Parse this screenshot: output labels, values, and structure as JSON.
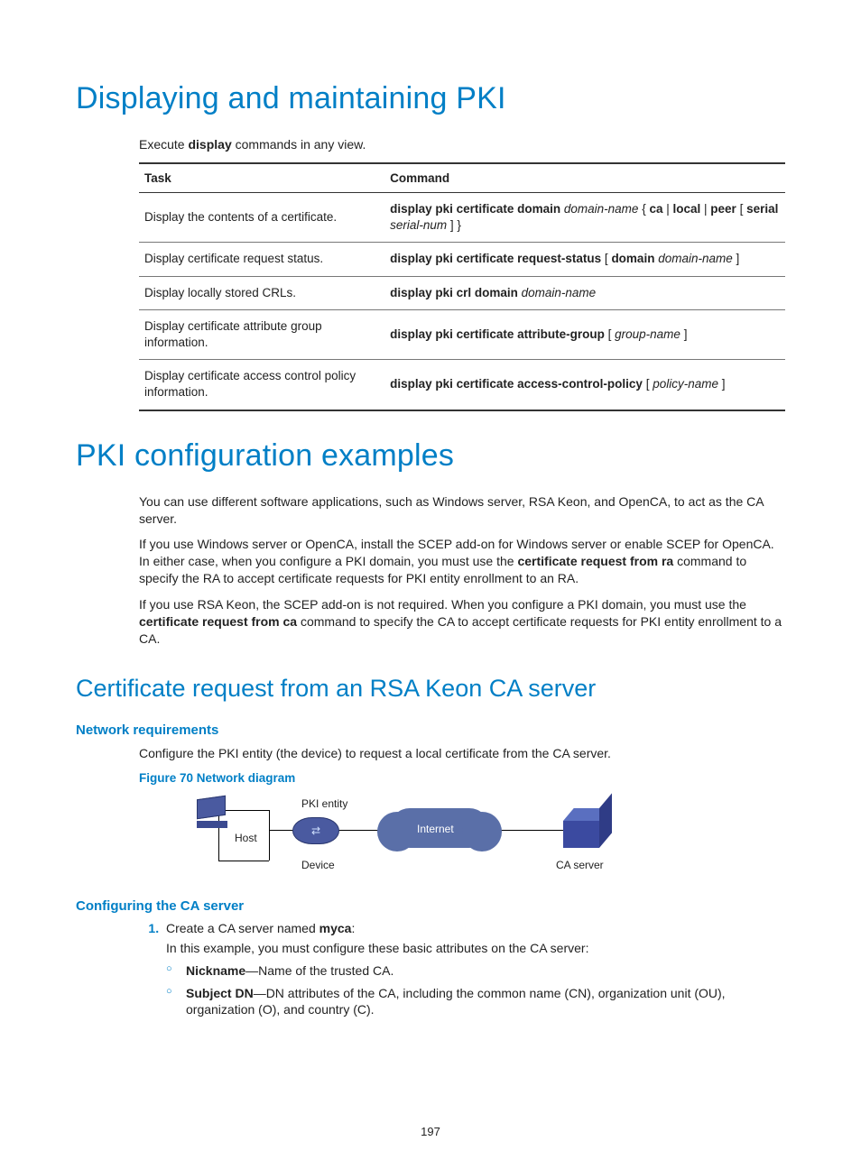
{
  "h1_a": "Displaying and maintaining PKI",
  "intro_a_pre": "Execute ",
  "intro_a_bold": "display",
  "intro_a_post": " commands in any view.",
  "table": {
    "head_task": "Task",
    "head_cmd": "Command",
    "rows": [
      {
        "task": "Display the contents of a certificate.",
        "cmd_parts": [
          {
            "t": "display pki certificate domain ",
            "b": true
          },
          {
            "t": "domain-name ",
            "i": true
          },
          {
            "t": "{ ",
            "b": false
          },
          {
            "t": "ca",
            "b": true
          },
          {
            "t": " | ",
            "b": false
          },
          {
            "t": "local",
            "b": true
          },
          {
            "t": " | ",
            "b": false
          },
          {
            "t": "peer",
            "b": true
          },
          {
            "t": " [ ",
            "b": false
          },
          {
            "t": "serial ",
            "b": true
          },
          {
            "t": "serial-num",
            "i": true
          },
          {
            "t": " ] }",
            "b": false
          }
        ]
      },
      {
        "task": "Display certificate request status.",
        "cmd_parts": [
          {
            "t": "display pki certificate request-status ",
            "b": true
          },
          {
            "t": "[ ",
            "b": false
          },
          {
            "t": "domain ",
            "b": true
          },
          {
            "t": "domain-name",
            "i": true
          },
          {
            "t": " ]",
            "b": false
          }
        ]
      },
      {
        "task": "Display locally stored CRLs.",
        "cmd_parts": [
          {
            "t": "display pki crl domain ",
            "b": true
          },
          {
            "t": "domain-name",
            "i": true
          }
        ]
      },
      {
        "task": "Display certificate attribute group information.",
        "cmd_parts": [
          {
            "t": "display pki certificate attribute-group ",
            "b": true
          },
          {
            "t": "[ ",
            "b": false
          },
          {
            "t": "group-name",
            "i": true
          },
          {
            "t": " ]",
            "b": false
          }
        ]
      },
      {
        "task": "Display certificate access control policy information.",
        "cmd_parts": [
          {
            "t": "display pki certificate access-control-policy ",
            "b": true
          },
          {
            "t": "[ ",
            "b": false
          },
          {
            "t": "policy-name",
            "i": true
          },
          {
            "t": " ]",
            "b": false
          }
        ]
      }
    ]
  },
  "h1_b": "PKI configuration examples",
  "p_b1": "You can use different software applications, such as Windows server, RSA Keon, and OpenCA, to act as the CA server.",
  "p_b2_pre": "If you use Windows server or OpenCA, install the SCEP add-on for Windows server or enable SCEP for OpenCA. In either case, when you configure a PKI domain, you must use the ",
  "p_b2_bold": "certificate request from ra",
  "p_b2_post": " command to specify the RA to accept certificate requests for PKI entity enrollment to an RA.",
  "p_b3_pre": "If you use RSA Keon, the SCEP add-on is not required. When you configure a PKI domain, you must use the ",
  "p_b3_bold": "certificate request from ca",
  "p_b3_post": " command to specify the CA to accept certificate requests for PKI entity enrollment to a CA.",
  "h2_c": "Certificate request from an RSA Keon CA server",
  "h3_c1": "Network requirements",
  "p_c1": "Configure the PKI entity (the device) to request a local certificate from the CA server.",
  "fig_cap": "Figure 70 Network diagram",
  "diagram": {
    "host": "Host",
    "entity": "PKI entity",
    "device": "Device",
    "internet": "Internet",
    "caserver": "CA server"
  },
  "h3_c2": "Configuring the CA server",
  "step1_pre": "Create a CA server named ",
  "step1_bold": "myca",
  "step1_post": ":",
  "step1_body": "In this example, you must configure these basic attributes on the CA server:",
  "bullet1_bold": "Nickname",
  "bullet1_post": "—Name of the trusted CA.",
  "bullet2_bold": "Subject DN",
  "bullet2_post": "—DN attributes of the CA, including the common name (CN), organization unit (OU), organization (O), and country (C).",
  "page_number": "197"
}
